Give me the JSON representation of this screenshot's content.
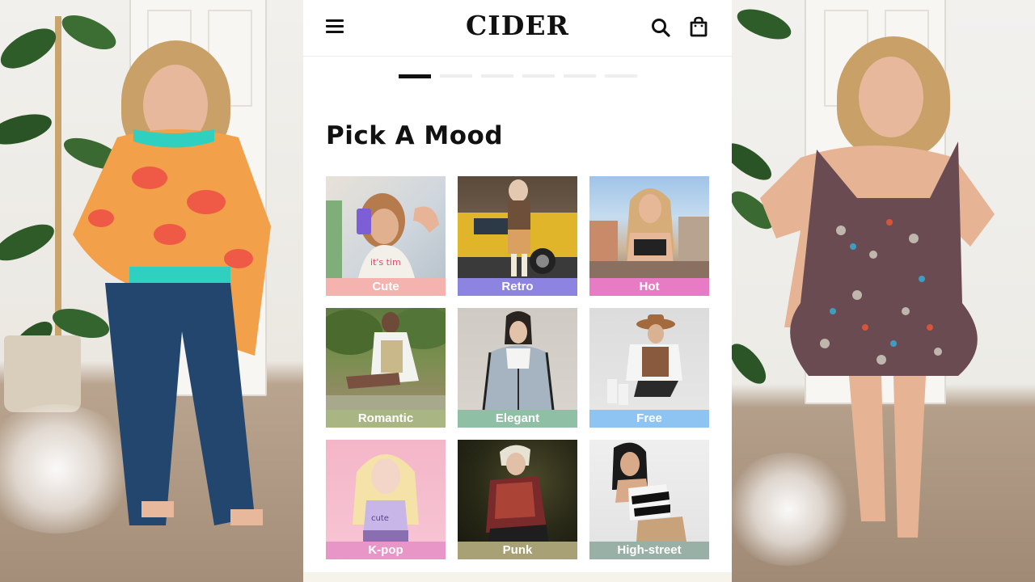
{
  "header": {
    "brand": "CIDER",
    "menu_icon": "hamburger-menu-icon",
    "search_icon": "search-icon",
    "bag_icon": "shopping-bag-icon"
  },
  "carousel": {
    "total_pages": 6,
    "active_index": 0
  },
  "section": {
    "title": "Pick A Mood"
  },
  "moods": [
    {
      "label": "Cute",
      "color": "#f5b3b0"
    },
    {
      "label": "Retro",
      "color": "#8c84e0"
    },
    {
      "label": "Hot",
      "color": "#e87cc4"
    },
    {
      "label": "Romantic",
      "color": "#aab584"
    },
    {
      "label": "Elegant",
      "color": "#8fc0a6"
    },
    {
      "label": "Free",
      "color": "#8dc4f2"
    },
    {
      "label": "K-pop",
      "color": "#e895c8"
    },
    {
      "label": "Punk",
      "color": "#a8a175"
    },
    {
      "label": "High-street",
      "color": "#98b0a6"
    }
  ]
}
